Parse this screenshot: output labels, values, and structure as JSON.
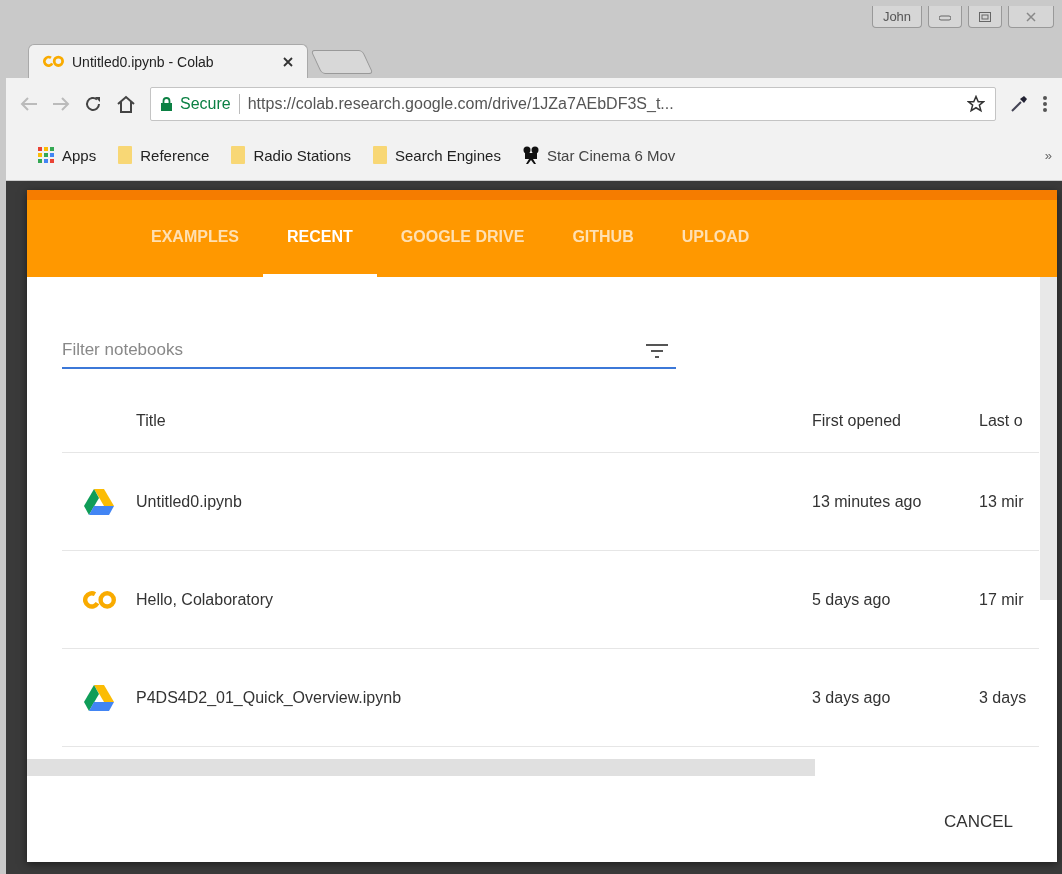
{
  "window": {
    "user": "John"
  },
  "browser_tab": {
    "title": "Untitled0.ipynb - Colab",
    "selected": true
  },
  "address_bar": {
    "secure_label": "Secure",
    "url": "https://colab.research.google.com/drive/1JZa7AEbDF3S_t..."
  },
  "bookmarks": [
    {
      "label": "Apps",
      "kind": "apps"
    },
    {
      "label": "Reference",
      "kind": "folder"
    },
    {
      "label": "Radio Stations",
      "kind": "folder"
    },
    {
      "label": "Search Engines",
      "kind": "folder"
    },
    {
      "label": "Star Cinema 6 Mov",
      "kind": "film"
    }
  ],
  "bookmarks_overflow": "»",
  "dialog": {
    "tabs": [
      {
        "label": "EXAMPLES",
        "selected": false
      },
      {
        "label": "RECENT",
        "selected": true
      },
      {
        "label": "GOOGLE DRIVE",
        "selected": false
      },
      {
        "label": "GITHUB",
        "selected": false
      },
      {
        "label": "UPLOAD",
        "selected": false
      }
    ],
    "filter": {
      "placeholder": "Filter notebooks"
    },
    "table": {
      "columns": [
        "Title",
        "First opened",
        "Last o"
      ],
      "rows": [
        {
          "kind": "drive",
          "title": "Untitled0.ipynb",
          "first_opened": "13 minutes ago",
          "last_opened": "13 mir"
        },
        {
          "kind": "colab",
          "title": "Hello, Colaboratory",
          "first_opened": "5 days ago",
          "last_opened": "17 mir"
        },
        {
          "kind": "drive",
          "title": "P4DS4D2_01_Quick_Overview.ipynb",
          "first_opened": "3 days ago",
          "last_opened": "3 days"
        }
      ]
    },
    "buttons": [
      "CANCEL"
    ]
  }
}
